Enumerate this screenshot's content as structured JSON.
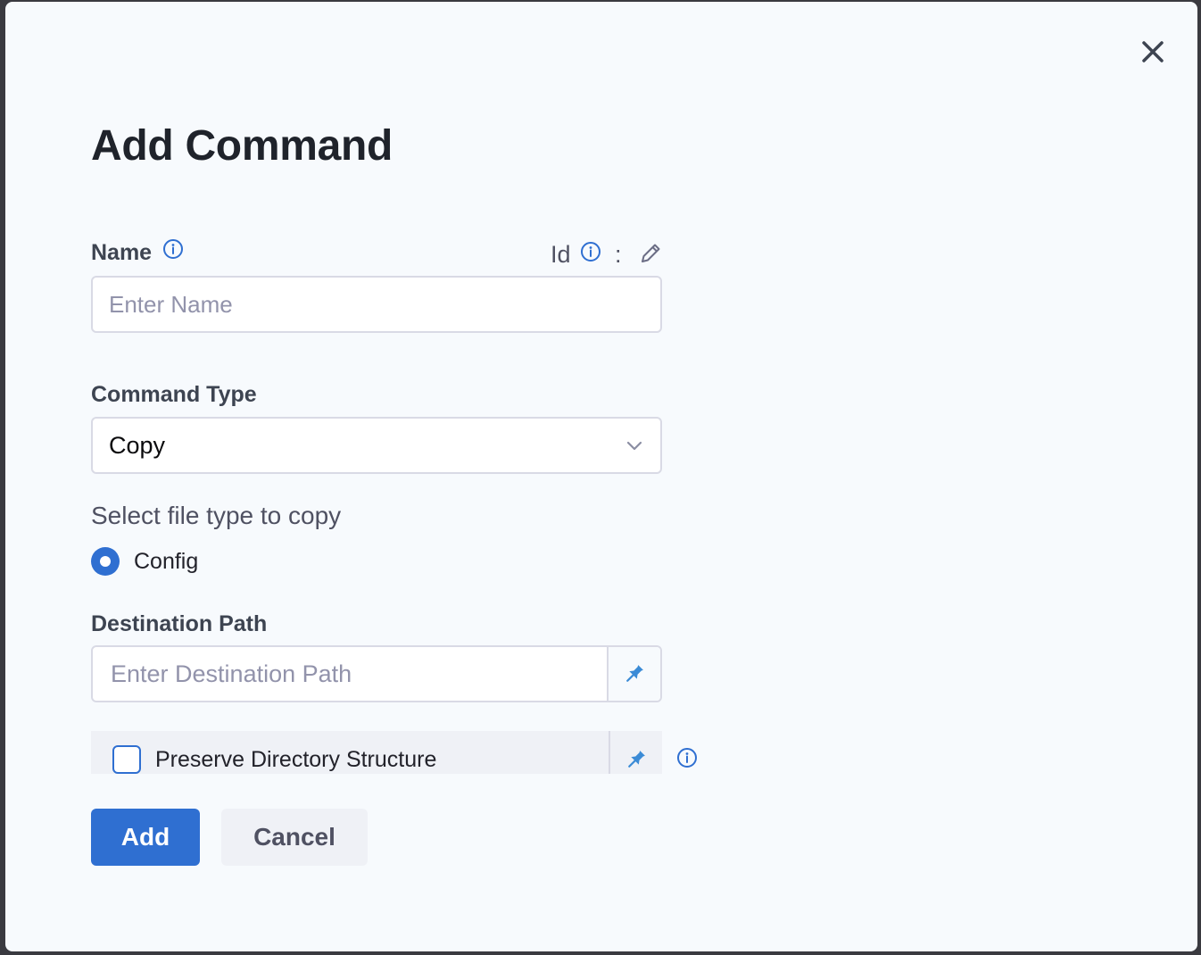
{
  "dialog": {
    "title": "Add Command",
    "close_icon": "close-icon"
  },
  "name_field": {
    "label": "Name",
    "placeholder": "Enter Name",
    "value": "",
    "id_label": "Id",
    "id_separator": ":"
  },
  "command_type": {
    "label": "Command Type",
    "selected": "Copy"
  },
  "file_type": {
    "label": "Select file type to copy",
    "options": [
      {
        "label": "Config",
        "selected": true
      }
    ]
  },
  "destination_path": {
    "label": "Destination Path",
    "placeholder": "Enter Destination Path",
    "value": ""
  },
  "preserve_directory": {
    "label": "Preserve Directory Structure",
    "checked": false
  },
  "buttons": {
    "add": "Add",
    "cancel": "Cancel"
  },
  "colors": {
    "primary": "#2f6fd1",
    "background": "#f7fafd",
    "text_dark": "#1f232b",
    "pin": "#3b8bd6"
  }
}
